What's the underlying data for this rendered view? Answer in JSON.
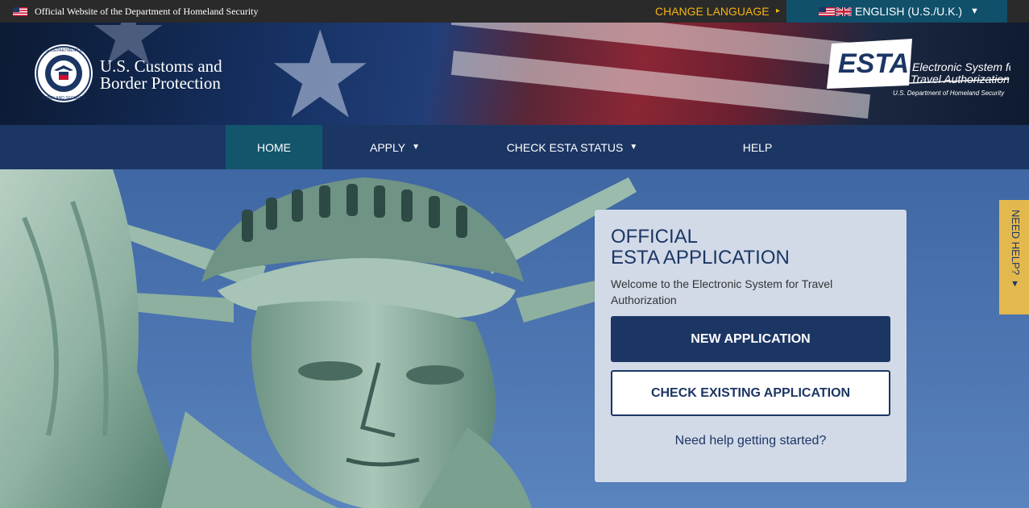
{
  "topbar": {
    "official_text": "Official Website of the Department of Homeland Security",
    "change_language": "CHANGE LANGUAGE",
    "language_selected": "ENGLISH (U.S./U.K.)"
  },
  "header": {
    "agency_line1": "U.S. Customs and",
    "agency_line2": "Border Protection",
    "seal_text_top": "U.S. DEPARTMENT OF",
    "seal_text_bottom": "HOMELAND SECURITY",
    "esta_wordmark": "ESTA",
    "esta_desc_line1": "Electronic System for",
    "esta_desc_line2": "Travel Authorization",
    "esta_dept": "U.S. Department of Homeland Security"
  },
  "nav": {
    "items": [
      {
        "label": "HOME"
      },
      {
        "label": "APPLY"
      },
      {
        "label": "CHECK ESTA STATUS"
      },
      {
        "label": "HELP"
      }
    ]
  },
  "panel": {
    "title_line1": "OFFICIAL",
    "title_line2": "ESTA APPLICATION",
    "welcome": "Welcome to the Electronic System for Travel Authorization",
    "new_application": "NEW APPLICATION",
    "check_existing": "CHECK EXISTING APPLICATION",
    "help_link": "Need help getting started?"
  },
  "side_tab": {
    "label": "NEED HELP? ▾"
  },
  "colors": {
    "navy": "#1c3664",
    "teal_active": "#13566c",
    "gold": "#f6b40e",
    "help_tab": "#e3b84c"
  },
  "icons": [
    "us-flag-icon",
    "uk-flag-icon",
    "caret-down-icon",
    "dhs-seal-icon",
    "esta-logo-icon"
  ]
}
